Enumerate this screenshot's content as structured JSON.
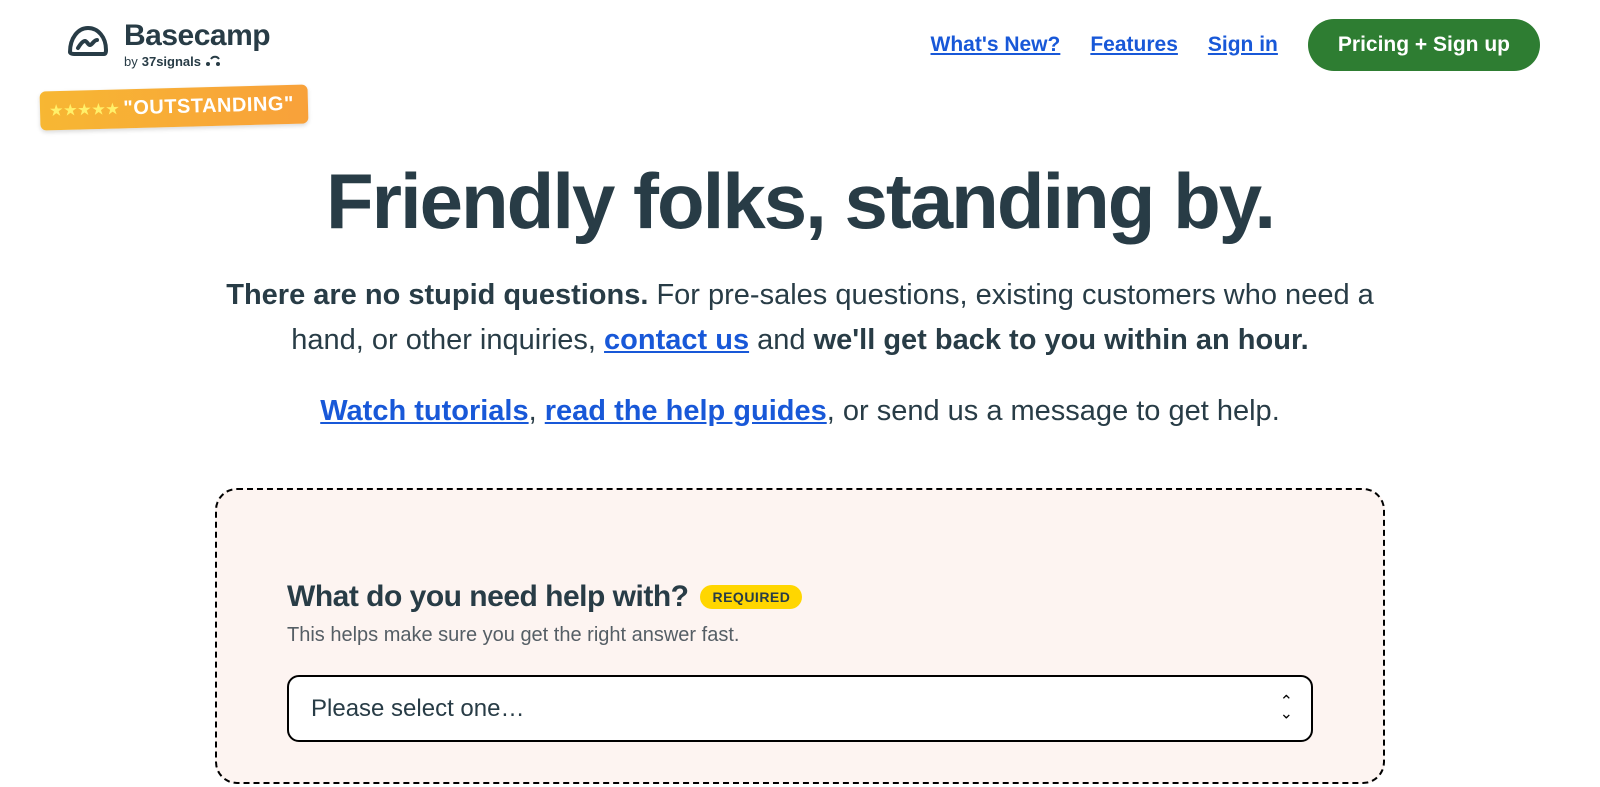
{
  "header": {
    "logo_name": "Basecamp",
    "logo_by_prefix": "by ",
    "logo_by_brand": "37signals",
    "nav": {
      "whats_new": "What's New?",
      "features": "Features",
      "sign_in": "Sign in",
      "cta": "Pricing + Sign up"
    }
  },
  "badge": {
    "stars": 5,
    "text": "\"OUTSTANDING\""
  },
  "hero": {
    "title": "Friendly folks, standing by.",
    "sub_bold_lead": "There are no stupid questions.",
    "sub_text_1": " For pre-sales questions, existing customers who need a hand, or other inquiries, ",
    "sub_link_contact": "contact us",
    "sub_text_2": " and ",
    "sub_bold_tail": "we'll get back to you within an hour.",
    "links_watch": "Watch tutorials",
    "links_sep": ", ",
    "links_read": "read the help guides",
    "links_tail": ", or send us a message to get help."
  },
  "form": {
    "label": "What do you need help with?",
    "required": "REQUIRED",
    "help": "This helps make sure you get the right answer fast.",
    "select_placeholder": "Please select one…"
  }
}
